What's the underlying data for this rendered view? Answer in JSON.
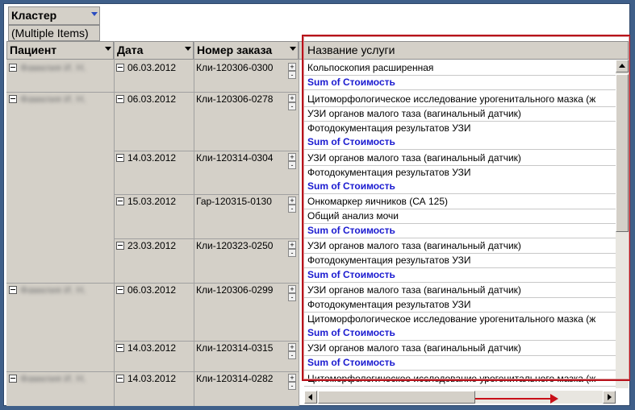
{
  "filter": {
    "label": "Кластер",
    "value": "(Multiple Items)"
  },
  "columns": {
    "patient": "Пациент",
    "date": "Дата",
    "order": "Номер заказа",
    "service": "Название услуги"
  },
  "patients": [
    "Фамилия И. Н.",
    "Фамилия И. Н.",
    "Фамилия И. Н.",
    "Фамилия И. Н."
  ],
  "dates": [
    "06.03.2012",
    "06.03.2012",
    "14.03.2012",
    "15.03.2012",
    "23.03.2012",
    "06.03.2012",
    "14.03.2012",
    "14.03.2012"
  ],
  "orders": [
    "Кли-120306-0300",
    "Кли-120306-0278",
    "Кли-120314-0304",
    "Гар-120315-0130",
    "Кли-120323-0250",
    "Кли-120306-0299",
    "Кли-120314-0315",
    "Кли-120314-0282"
  ],
  "services": [
    "Кольпоскопия расширенная",
    "Sum of Стоимость",
    "Цитоморфологическое исследование урогенитального мазка (ж",
    "УЗИ органов малого таза (вагинальный датчик)",
    "Фотодокументация результатов УЗИ",
    "Sum of Стоимость",
    "УЗИ органов малого таза (вагинальный датчик)",
    "Фотодокументация результатов УЗИ",
    "Sum of Стоимость",
    "Онкомаркер яичников (СА 125)",
    "Общий анализ мочи",
    "Sum of Стоимость",
    "УЗИ органов малого таза (вагинальный датчик)",
    "Фотодокументация результатов УЗИ",
    "Sum of Стоимость",
    "УЗИ органов малого таза (вагинальный датчик)",
    "Фотодокументация результатов УЗИ",
    "Цитоморфологическое исследование урогенитального мазка (ж",
    "Sum of Стоимость",
    "УЗИ органов малого таза (вагинальный датчик)",
    "Sum of Стоимость",
    "Цитоморфологическое исследование урогенитального мазка (ж"
  ],
  "expand_glyphs": [
    "+",
    "-"
  ],
  "colors": {
    "header_bg": "#d4d0c8",
    "sum_text": "#1a1ad0",
    "highlight": "#b8101a"
  }
}
